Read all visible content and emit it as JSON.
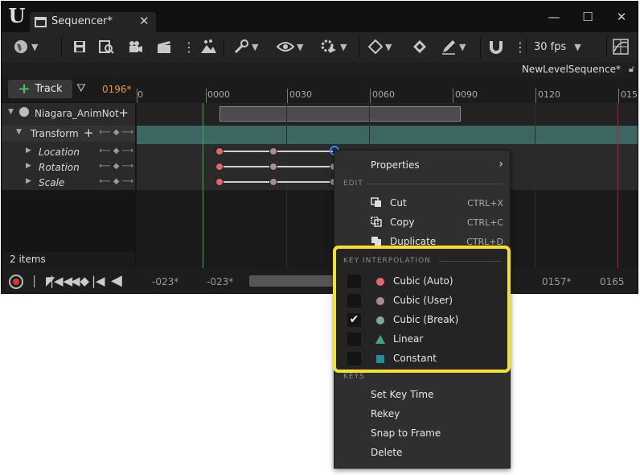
{
  "window": {
    "tab_title": "Sequencer*",
    "tab_close": "✕",
    "minimize": "—",
    "maximize": "☐",
    "close": "✕"
  },
  "toolbar": {
    "fps": "30 fps",
    "sequence_name": "NewLevelSequence*",
    "icons": [
      "world-icon",
      "save-icon",
      "browse-icon",
      "camera-icon",
      "clapper-icon",
      "more-icon",
      "render-icon",
      "wrench-icon",
      "eye-icon",
      "gear-play-icon",
      "diamond-key-icon",
      "autokey-icon",
      "pencil-icon",
      "magnet-icon",
      "more-icon",
      "grid-icon"
    ]
  },
  "track_bar": {
    "add_track_label": "Track",
    "frame_counter": "0196*"
  },
  "ruler": {
    "ticks": [
      "0",
      "0000",
      "0030",
      "0060",
      "0090",
      "0120",
      "015"
    ]
  },
  "outliner": {
    "actor": "Niagara_AnimNot",
    "transform": "Transform",
    "children": [
      "Location",
      "Rotation",
      "Scale"
    ],
    "nav_glyphs": "⟵ ◆ ⟶",
    "item_count": "2 items"
  },
  "bottom": {
    "times": [
      "-023*",
      "-023*",
      "0157*",
      "0165"
    ]
  },
  "context_menu": {
    "properties": "Properties",
    "edit_header": "EDIT",
    "edit_items": [
      {
        "label": "Cut",
        "shortcut": "CTRL+X"
      },
      {
        "label": "Copy",
        "shortcut": "CTRL+C"
      },
      {
        "label": "Duplicate",
        "shortcut": "CTRL+D"
      }
    ],
    "interp_header": "KEY INTERPOLATION",
    "interp_items": [
      {
        "label": "Cubic (Auto)",
        "checked": false,
        "color": "#e2686a"
      },
      {
        "label": "Cubic (User)",
        "checked": false,
        "color": "#a88c91"
      },
      {
        "label": "Cubic (Break)",
        "checked": true,
        "color": "#7fa898",
        "mark": "✔"
      },
      {
        "label": "Linear",
        "checked": false,
        "color": "#3ca884"
      },
      {
        "label": "Constant",
        "checked": false,
        "color": "#268b9c"
      }
    ],
    "keys_header": "KEYS",
    "key_items": [
      "Set Key Time",
      "Rekey",
      "Snap to Frame",
      "Delete"
    ]
  },
  "colors": {
    "accent_yellow": "#f4e12a",
    "frame_counter": "#e39a36",
    "transform_lane": "#3b6661",
    "playhead_start": "#3cb043",
    "playhead_end": "#b22222"
  }
}
